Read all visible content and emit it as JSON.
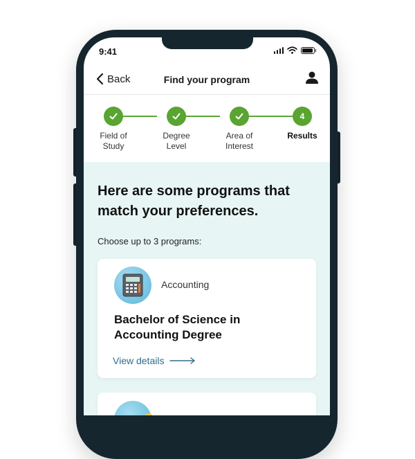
{
  "status_bar": {
    "time": "9:41"
  },
  "nav": {
    "back_label": "Back",
    "title": "Find your program"
  },
  "stepper": {
    "steps": [
      {
        "label": "Field of Study",
        "completed": true
      },
      {
        "label": "Degree Level",
        "completed": true
      },
      {
        "label": "Area of Interest",
        "completed": true
      },
      {
        "label": "Results",
        "number": "4",
        "active": true
      }
    ]
  },
  "content": {
    "headline": "Here are some programs that match your preferences.",
    "subhead": "Choose up to 3 programs:",
    "cards": [
      {
        "category": "Accounting",
        "icon": "calculator-icon",
        "title": "Bachelor of Science in Accounting Degree",
        "link_label": "View details"
      }
    ]
  },
  "colors": {
    "accent_green": "#5aa431",
    "content_bg": "#e7f6f4",
    "link_blue": "#2d6e8d",
    "phone_frame": "#16262e"
  }
}
